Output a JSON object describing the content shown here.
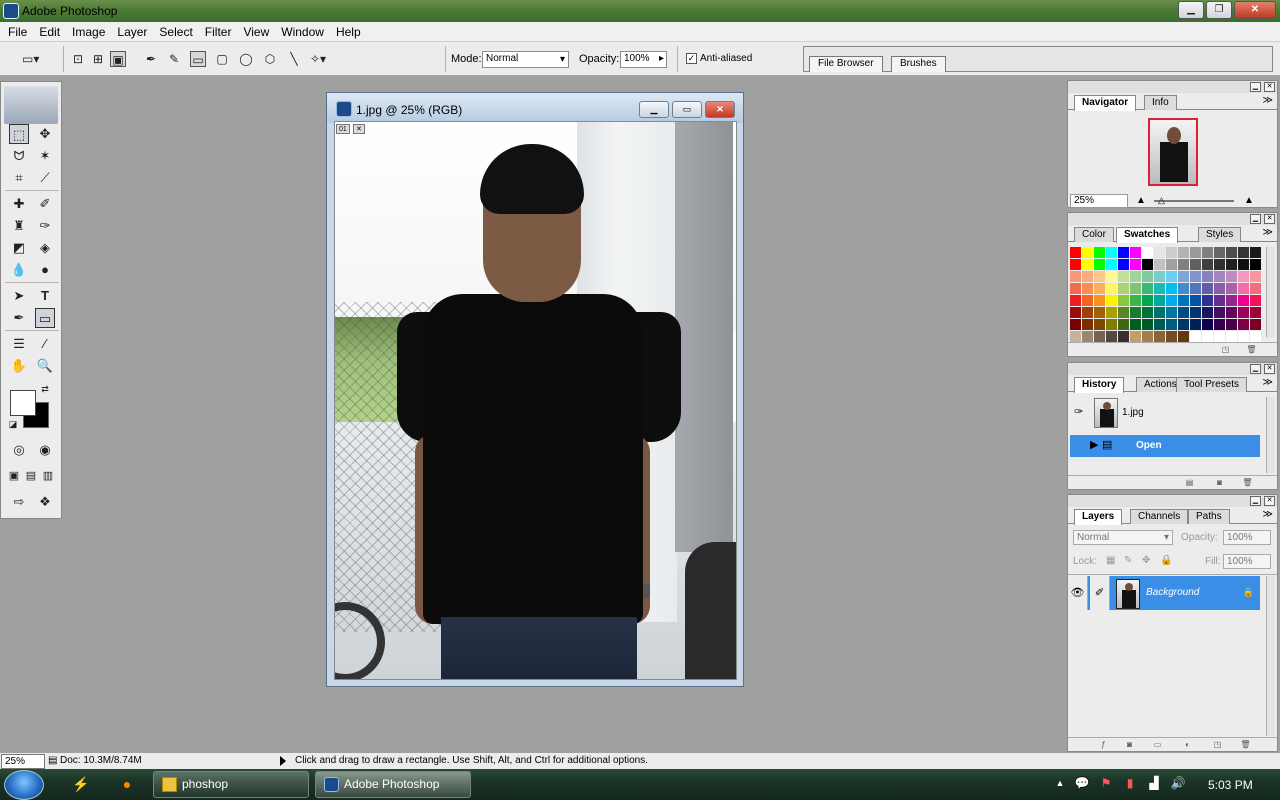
{
  "window": {
    "title": "Adobe Photoshop"
  },
  "menu": [
    "File",
    "Edit",
    "Image",
    "Layer",
    "Select",
    "Filter",
    "View",
    "Window",
    "Help"
  ],
  "options": {
    "mode_label": "Mode:",
    "mode_value": "Normal",
    "opacity_label": "Opacity:",
    "opacity_value": "100%",
    "antialiased_label": "Anti-aliased",
    "antialiased_checked": true,
    "well_tabs": [
      "File Browser",
      "Brushes"
    ]
  },
  "document": {
    "title": "1.jpg @ 25% (RGB)",
    "ruler_tag": "01"
  },
  "navigator": {
    "tabs": [
      "Navigator",
      "Info"
    ],
    "zoom": "25%"
  },
  "color_panel": {
    "tabs": [
      "Color",
      "Swatches",
      "Styles"
    ],
    "swatch_colors": [
      "#ff0000",
      "#ffff00",
      "#00ff00",
      "#00ffff",
      "#0000ff",
      "#ff00ff",
      "#ffffff",
      "#e6e6e6",
      "#cccccc",
      "#b3b3b3",
      "#999999",
      "#808080",
      "#666666",
      "#4d4d4d",
      "#333333",
      "#1a1a1a",
      "#ff0000",
      "#ffff00",
      "#00ff00",
      "#00ffff",
      "#0000ff",
      "#ff00ff",
      "#000000",
      "#c0c0c0",
      "#a0a0a0",
      "#808080",
      "#606060",
      "#404040",
      "#303030",
      "#202020",
      "#101010",
      "#000000",
      "#f7977a",
      "#f9ad81",
      "#fdc68a",
      "#fff79a",
      "#c4df9b",
      "#a2d39c",
      "#82ca9d",
      "#7bcdc8",
      "#6ecff6",
      "#7ea7d8",
      "#8493ca",
      "#8882be",
      "#a187be",
      "#bc8dbf",
      "#f49ac2",
      "#f6989d",
      "#f26c4f",
      "#f68e55",
      "#fbaf5c",
      "#fff467",
      "#acd372",
      "#7cc576",
      "#3bb878",
      "#1abbb4",
      "#00bff3",
      "#438ccb",
      "#5574b9",
      "#605ca8",
      "#855fa8",
      "#a763a8",
      "#f06ea9",
      "#f26d7d",
      "#ed1c24",
      "#f26522",
      "#f7941d",
      "#fff200",
      "#8dc73f",
      "#39b54a",
      "#00a651",
      "#00a99d",
      "#00aeef",
      "#0072bc",
      "#0054a6",
      "#2e3192",
      "#662d91",
      "#92278f",
      "#ec008c",
      "#ed145b",
      "#9e0b0f",
      "#a0410d",
      "#a36209",
      "#aba000",
      "#598527",
      "#197b30",
      "#007236",
      "#00746b",
      "#0076a3",
      "#004b80",
      "#003471",
      "#1b1464",
      "#440e62",
      "#630460",
      "#9e005d",
      "#9e0039",
      "#790000",
      "#7b2e00",
      "#7d4900",
      "#827b00",
      "#406618",
      "#005e20",
      "#005826",
      "#005952",
      "#005b7f",
      "#003663",
      "#002157",
      "#0d004c",
      "#32004b",
      "#4b0049",
      "#7b0046",
      "#7a0026",
      "#c7b299",
      "#998675",
      "#736357",
      "#534741",
      "#37302d",
      "#c69c6d",
      "#a67c52",
      "#8c6239",
      "#754c24",
      "#603913",
      "#ffffff",
      "#ffffff",
      "#ffffff",
      "#ffffff",
      "#ffffff",
      "#ffffff"
    ]
  },
  "history": {
    "tabs": [
      "History",
      "Actions",
      "Tool Presets"
    ],
    "snapshot": "1.jpg",
    "items": [
      "Open"
    ]
  },
  "layers": {
    "tabs": [
      "Layers",
      "Channels",
      "Paths"
    ],
    "blend_mode": "Normal",
    "opacity_label": "Opacity:",
    "opacity_value": "100%",
    "lock_label": "Lock:",
    "fill_label": "Fill:",
    "fill_value": "100%",
    "layer_name": "Background"
  },
  "status": {
    "zoom": "25%",
    "doc": "Doc: 10.3M/8.74M",
    "hint": "Click and drag to draw a rectangle.  Use Shift, Alt, and Ctrl for additional options."
  },
  "taskbar": {
    "tasks": [
      "phoshop",
      "Adobe Photoshop"
    ],
    "clock": "5:03 PM"
  }
}
